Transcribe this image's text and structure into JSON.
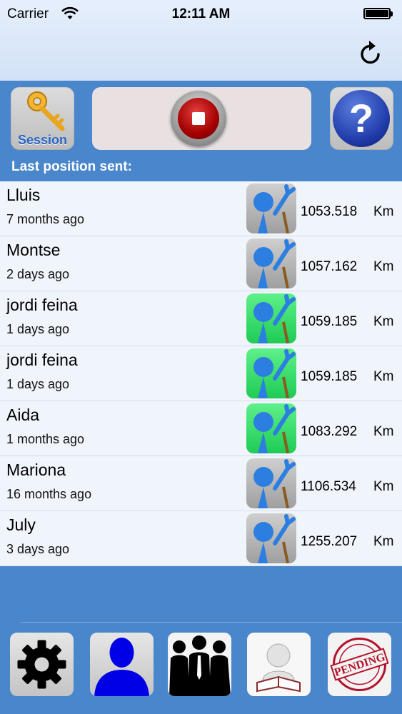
{
  "status_bar": {
    "carrier": "Carrier",
    "time": "12:11 AM"
  },
  "nav": {
    "refresh_icon": "refresh-icon"
  },
  "controls": {
    "session_label": "Session",
    "stop_icon": "stop-record-icon",
    "help_icon": "help-question-icon",
    "help_glyph": "?",
    "section_title": "Last position sent:"
  },
  "contacts": [
    {
      "name": "Lluis",
      "last_seen": "7 months ago",
      "distance": "1053.518",
      "unit": "Km",
      "active": false
    },
    {
      "name": "Montse",
      "last_seen": "2 days ago",
      "distance": "1057.162",
      "unit": "Km",
      "active": false
    },
    {
      "name": "jordi feina",
      "last_seen": "1 days ago",
      "distance": "1059.185",
      "unit": "Km",
      "active": true
    },
    {
      "name": "jordi feina",
      "last_seen": "1 days ago",
      "distance": "1059.185",
      "unit": "Km",
      "active": true
    },
    {
      "name": "Aida",
      "last_seen": "1 months ago",
      "distance": "1083.292",
      "unit": "Km",
      "active": true
    },
    {
      "name": "Mariona",
      "last_seen": "16 months ago",
      "distance": "1106.534",
      "unit": "Km",
      "active": false
    },
    {
      "name": "July",
      "last_seen": "3 days ago",
      "distance": "1255.207",
      "unit": "Km",
      "active": false
    }
  ],
  "toolbar": {
    "items": [
      {
        "icon": "settings-gear-icon"
      },
      {
        "icon": "user-profile-icon"
      },
      {
        "icon": "group-people-icon"
      },
      {
        "icon": "reading-person-icon"
      },
      {
        "icon": "pending-stamp-icon",
        "stamp_text": "PENDING"
      }
    ]
  },
  "colors": {
    "background_blue": "#4a86cc",
    "active_green": "#2ee064",
    "stop_red": "#c00000"
  }
}
